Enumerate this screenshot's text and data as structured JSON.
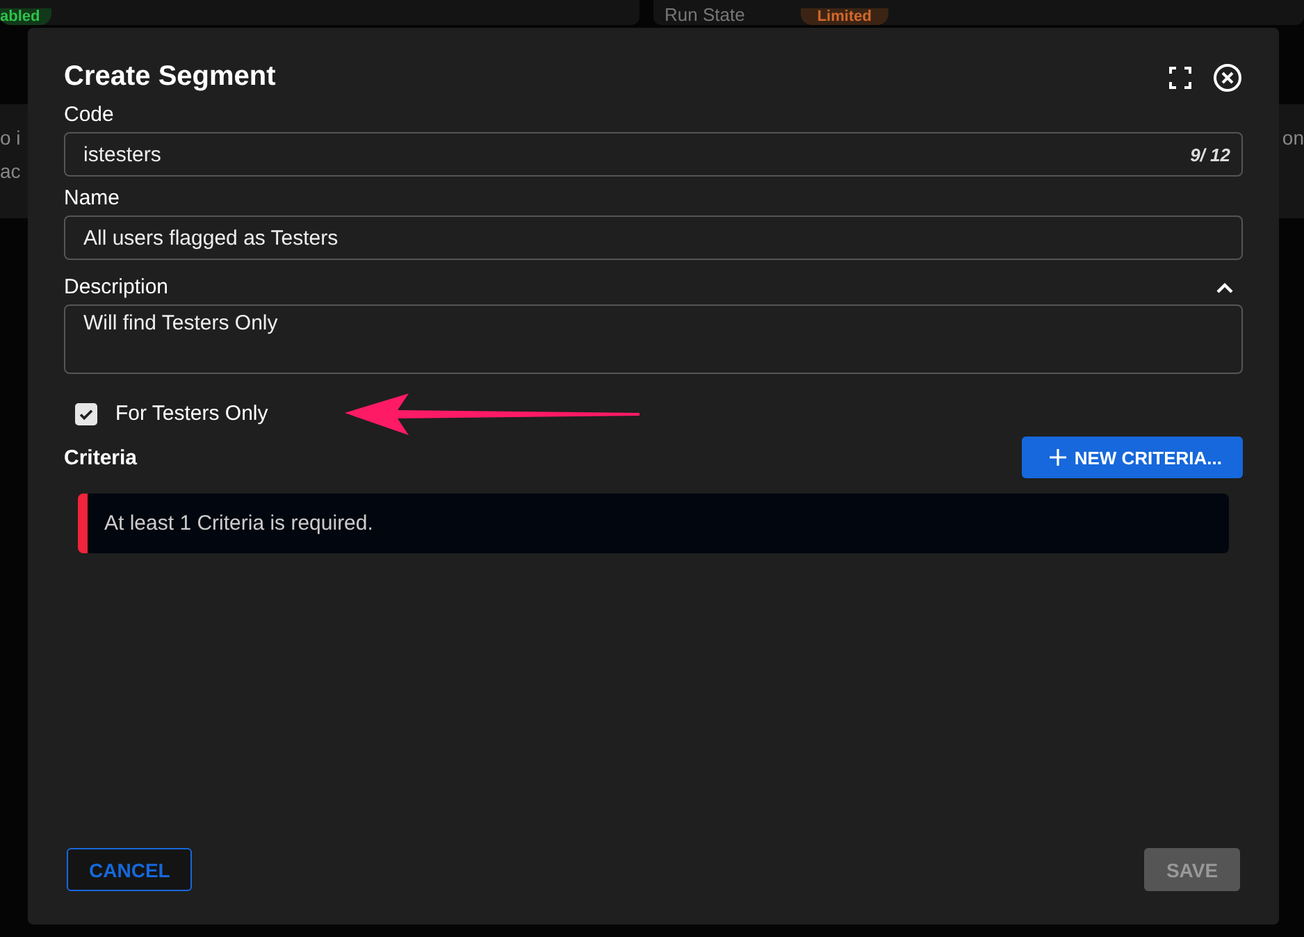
{
  "background": {
    "status_badge": "abled",
    "run_state_label": "Run State",
    "run_state_badge": "Limited",
    "text_left_1": "o i",
    "text_left_2": "ac",
    "text_right": "on"
  },
  "dialog": {
    "title": "Create Segment",
    "code": {
      "label": "Code",
      "value": "istesters",
      "counter": "9/ 12"
    },
    "name": {
      "label": "Name",
      "value": "All users flagged as Testers"
    },
    "description": {
      "label": "Description",
      "value": "Will find Testers Only",
      "expanded": true
    },
    "testers_only": {
      "label": "For Testers Only",
      "checked": true
    },
    "criteria": {
      "heading": "Criteria",
      "new_button": "NEW CRITERIA...",
      "error": "At least 1 Criteria is required."
    },
    "buttons": [
      {
        "label": "CANCEL",
        "kind": "outline",
        "disabled": false
      },
      {
        "label": "SAVE",
        "kind": "filled",
        "disabled": true
      }
    ]
  }
}
